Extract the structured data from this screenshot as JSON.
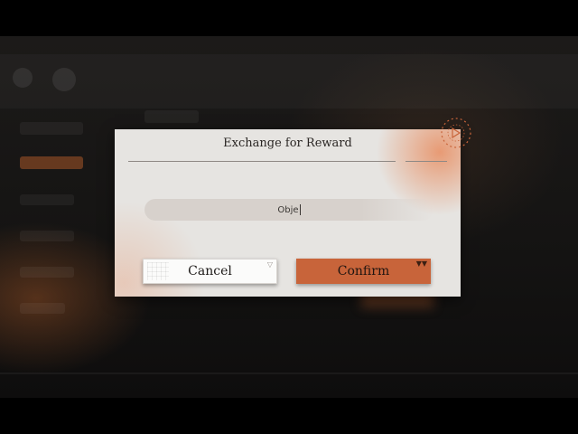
{
  "dialog": {
    "title": "Exchange for Reward",
    "input_value": "Obje",
    "cancel_label": "Cancel",
    "confirm_label": "Confirm"
  },
  "icons": {
    "cancel_corner": "triangle-down-outline-icon",
    "confirm_corner": "triangle-down-filled-icon",
    "decoration": "target-arrow-icon"
  },
  "colors": {
    "accent": "#c8643a",
    "dialog_bg": "#e6e4e1",
    "cancel_bg": "#fbfbfa",
    "text_dark": "#2a2624"
  }
}
